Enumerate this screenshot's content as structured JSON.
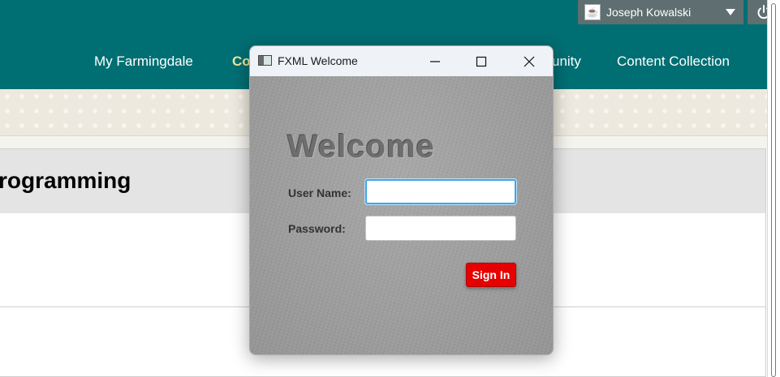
{
  "header": {
    "user_name": "Joseph Kowalski",
    "nav": [
      "My Farmingdale",
      "Co",
      "unity",
      "Content Collection"
    ]
  },
  "course": {
    "title_visible": "rogramming"
  },
  "dialog": {
    "title": "FXML Welcome",
    "heading": "Welcome",
    "username_label": "User Name:",
    "username_value": "",
    "password_label": "Password:",
    "password_value": "",
    "signin_label": "Sign In"
  },
  "colors": {
    "topbar": "#006f73",
    "user_menu": "#5f6e70",
    "signin_button": "#e60000",
    "focus_border": "#3fa6e6"
  },
  "icons": [
    "java-icon",
    "chevron-down-icon",
    "power-icon",
    "app-window-icon",
    "minimize-icon",
    "maximize-icon",
    "close-icon"
  ]
}
